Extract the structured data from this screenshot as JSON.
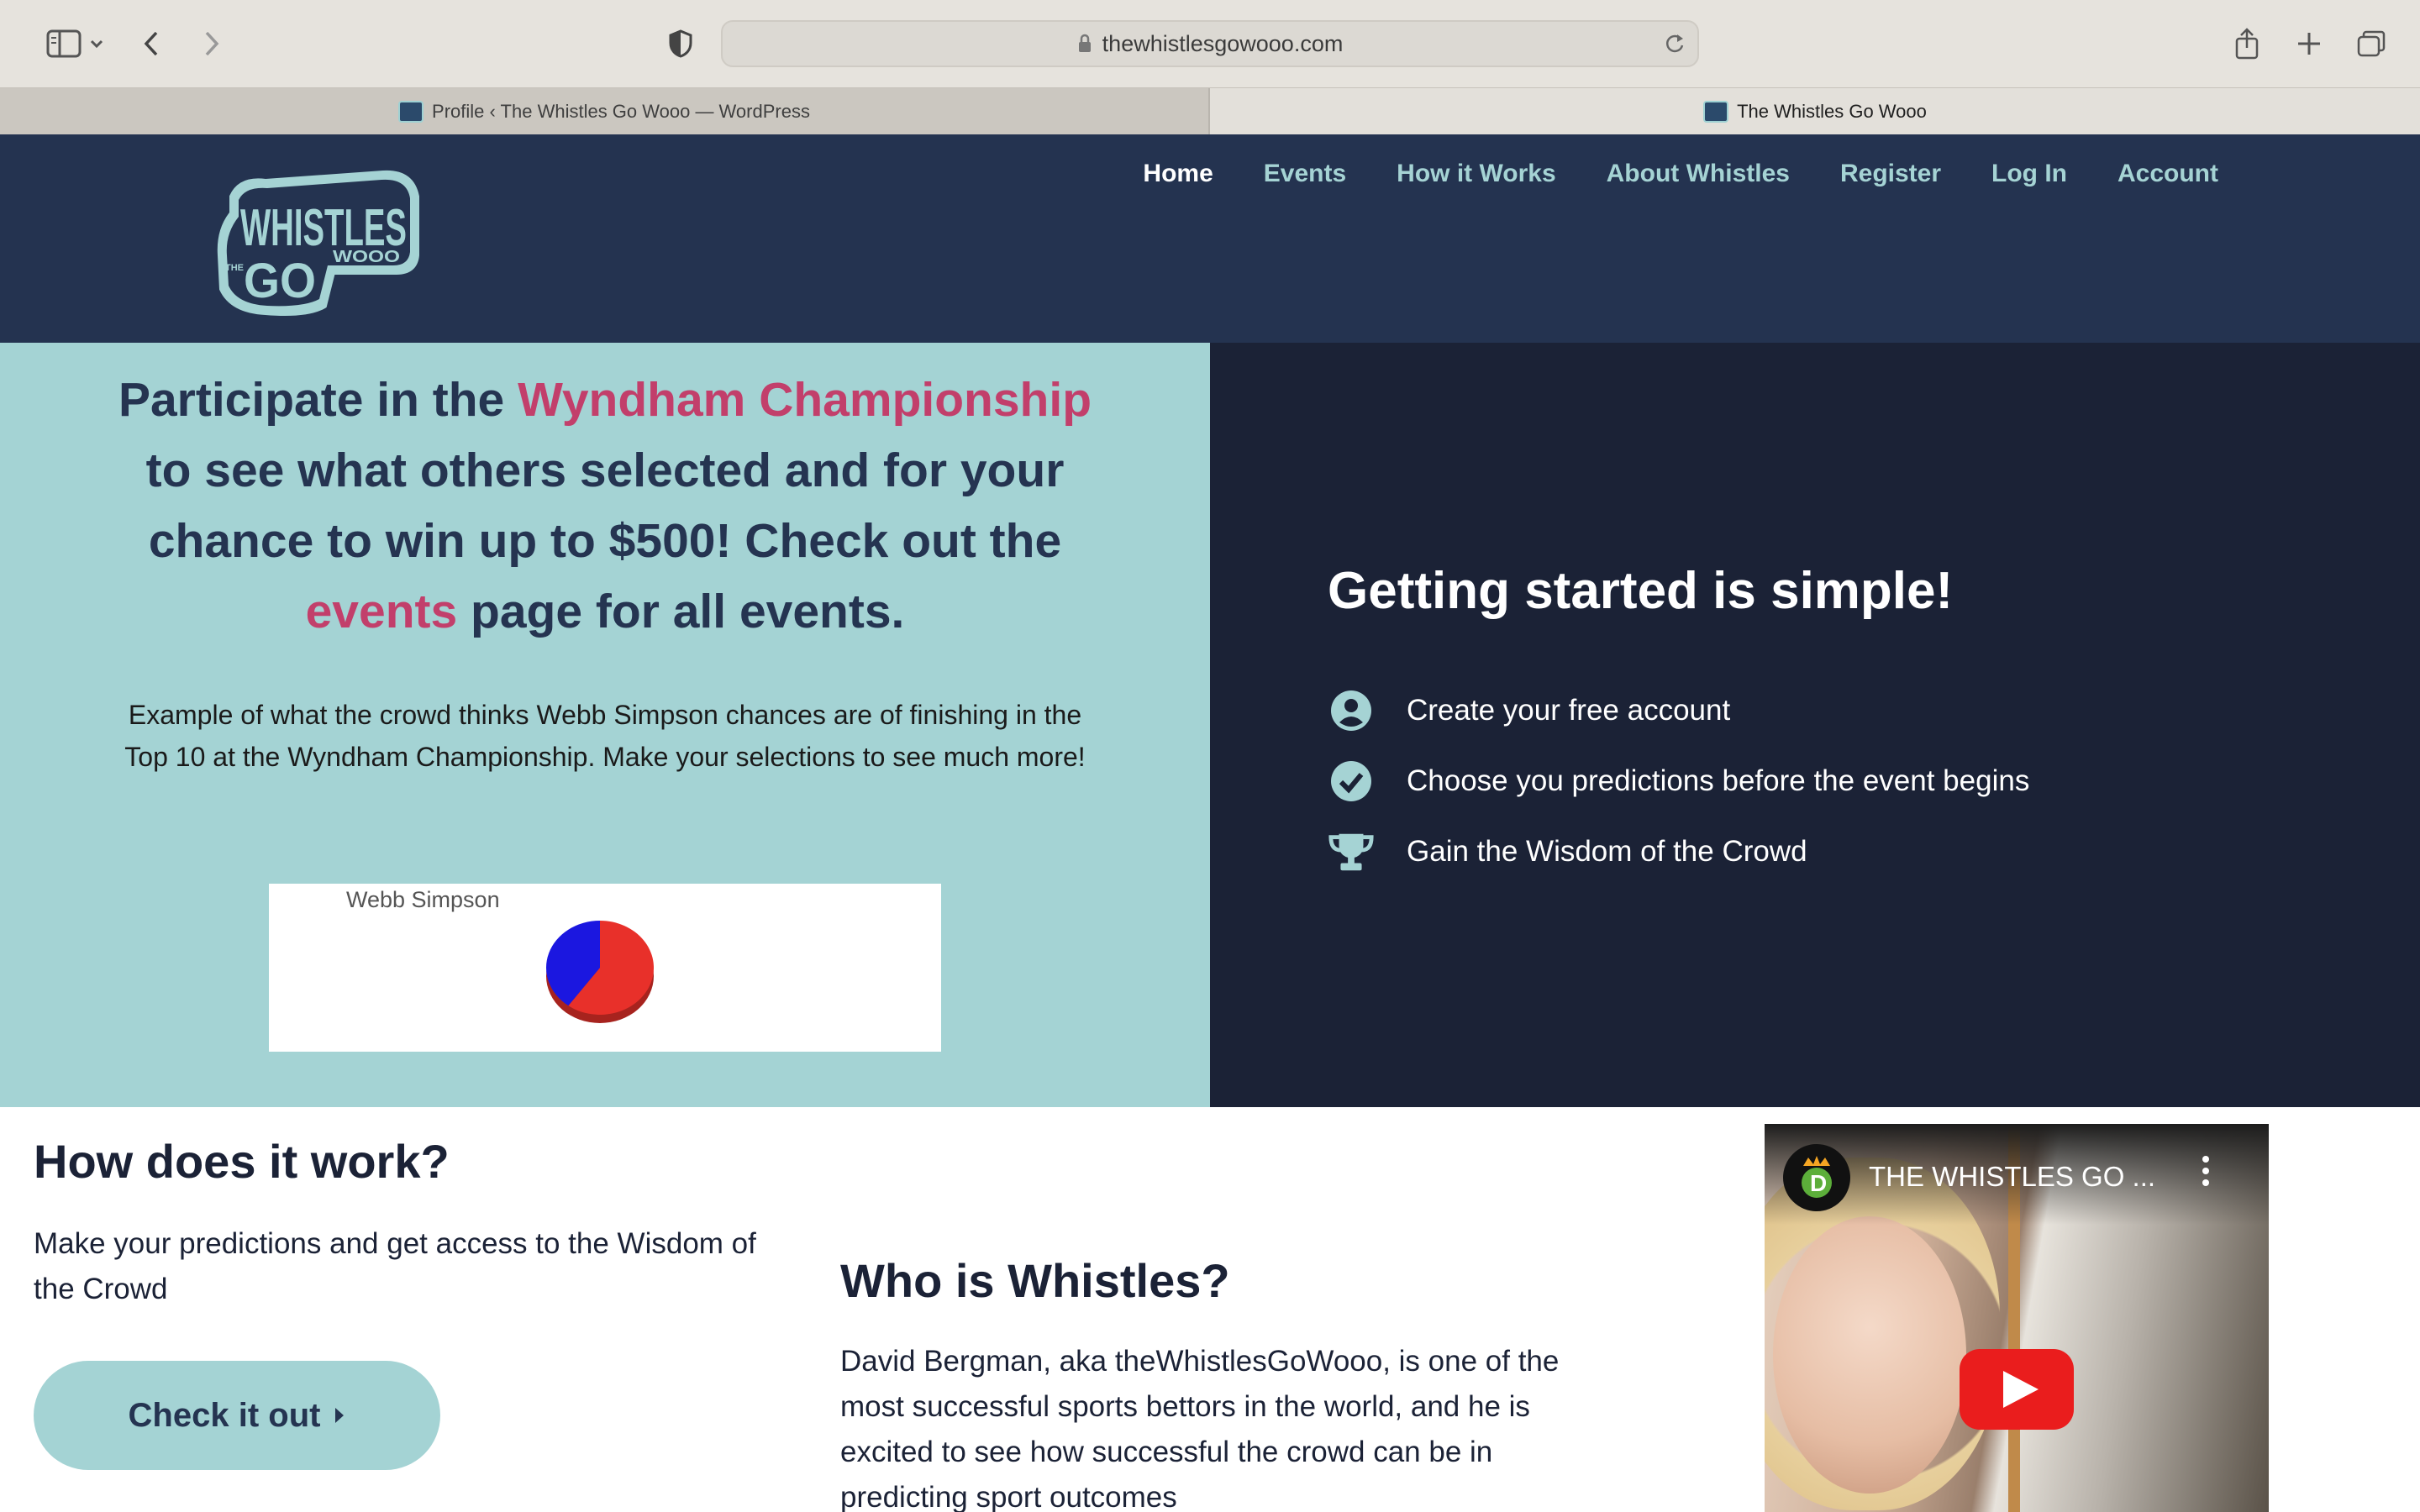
{
  "browser": {
    "url": "thewhistlesgowooo.com",
    "tabs": [
      {
        "label": "Profile ‹ The Whistles Go Wooo — WordPress"
      },
      {
        "label": "The Whistles Go Wooo"
      }
    ]
  },
  "site": {
    "logo": {
      "line1": "WHISTLES",
      "line2": "GO",
      "line3": "WOOO",
      "small": "THE"
    },
    "nav": [
      "Home",
      "Events",
      "How it Works",
      "About Whistles",
      "Register",
      "Log In",
      "Account"
    ]
  },
  "hero": {
    "heading": {
      "part1": "Participate in the ",
      "highlight": "Wyndham Championship",
      "part2": " to see what others selected and for your chance to win up to $500! Check out the ",
      "link": "events",
      "part3": " page for all events."
    },
    "paragraph": "Example of what the crowd thinks Webb Simpson chances are of finishing in the Top 10 at the Wyndham Championship. Make your selections to see much more!"
  },
  "chart_data": {
    "type": "pie",
    "title": "Webb Simpson",
    "slices": [
      {
        "value": 60,
        "color": "#e8302a"
      },
      {
        "value": 40,
        "color": "#1b17e0"
      }
    ]
  },
  "getting_started": {
    "title": "Getting started is simple!",
    "items": [
      {
        "icon": "user-circle-icon",
        "text": "Create your free account"
      },
      {
        "icon": "check-circle-icon",
        "text": "Choose you predictions before the event begins"
      },
      {
        "icon": "trophy-icon",
        "text": "Gain the Wisdom of the Crowd"
      }
    ]
  },
  "how_it_works": {
    "title": "How does it work?",
    "text": "Make your predictions and get access to the Wisdom of the Crowd",
    "button": "Check it out"
  },
  "who": {
    "title": "Who is Whistles?",
    "text": "David Bergman, aka theWhistlesGoWooo, is one of the most successful sports bettors in the world, and he is excited to see how successful the crowd can be in predicting sport outcomes"
  },
  "video": {
    "title": "THE WHISTLES GO ..."
  },
  "colors": {
    "header_bg": "#243350",
    "nav_link": "#a5d3d4",
    "hero_left_bg": "#a4d3d4",
    "hero_right_bg": "#1b2236",
    "accent_pink": "#c23f6b"
  }
}
